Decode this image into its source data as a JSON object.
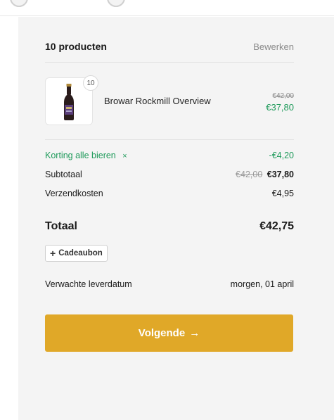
{
  "cart": {
    "title": "10 producten",
    "edit_label": "Bewerken",
    "item": {
      "quantity": "10",
      "name": "Browar Rockmill Overview",
      "old_price": "€42,00",
      "new_price": "€37,80"
    }
  },
  "summary": {
    "discount_label": "Korting alle bieren",
    "discount_remove": "×",
    "discount_value": "-€4,20",
    "subtotal_label": "Subtotaal",
    "subtotal_old": "€42,00",
    "subtotal_new": "€37,80",
    "shipping_label": "Verzendkosten",
    "shipping_value": "€4,95",
    "total_label": "Totaal",
    "total_value": "€42,75",
    "gift_plus": "+",
    "gift_label": "Cadeaubon",
    "delivery_label": "Verwachte leverdatum",
    "delivery_value": "morgen, 01 april"
  },
  "actions": {
    "next_label": "Volgende",
    "next_arrow": "→"
  },
  "colors": {
    "accent": "#e0a828",
    "green": "#1e9a5a",
    "panel": "#f4f4f4"
  }
}
